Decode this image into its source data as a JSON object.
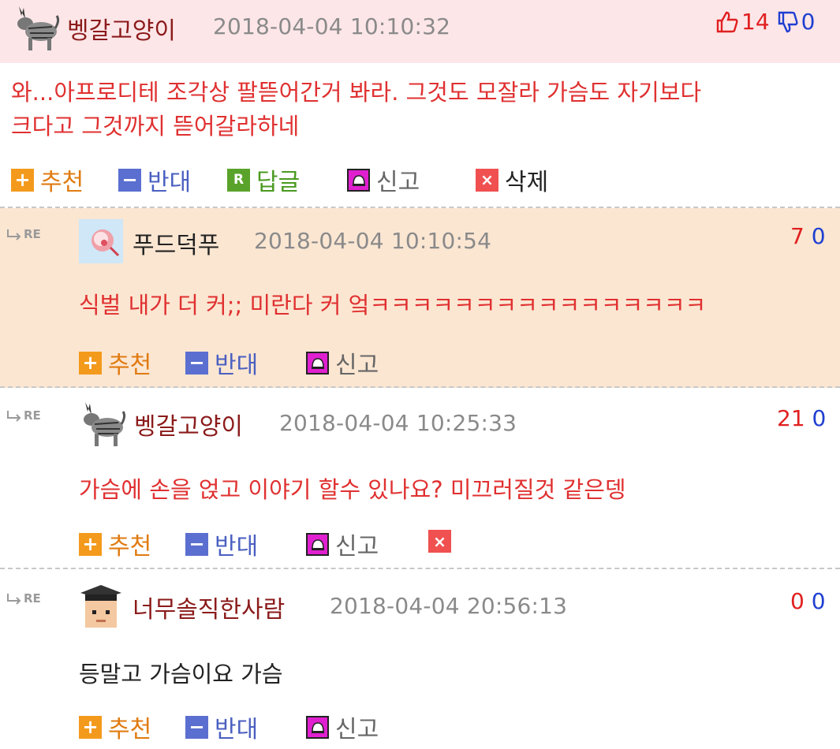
{
  "comments": [
    {
      "author": "벵갈고양이",
      "date": "2018-04-04 10:10:32",
      "up": "14",
      "down": "0",
      "body_lines": [
        "와...아프로디테 조각상 팔뜯어간거 봐라. 그것도 모잘라 가슴도 자기보다",
        "크다고 그것까지 뜯어갈라하네"
      ],
      "actions": {
        "recommend": "추천",
        "oppose": "반대",
        "reply": "답글",
        "report": "신고",
        "delete": "삭제"
      }
    },
    {
      "re": "RE",
      "author": "푸드덕푸",
      "date": "2018-04-04 10:10:54",
      "up": "7",
      "down": "0",
      "body": "식벌 내가 더 커;; 미란다 커 엌ㅋㅋㅋㅋㅋㅋㅋㅋㅋㅋㅋㅋㅋㅋㅋㅋ",
      "actions": {
        "recommend": "추천",
        "oppose": "반대",
        "report": "신고"
      }
    },
    {
      "re": "RE",
      "author": "벵갈고양이",
      "date": "2018-04-04 10:25:33",
      "up": "21",
      "down": "0",
      "body": "가슴에 손을 얹고 이야기 할수 있나요? 미끄러질것 같은뎅",
      "actions": {
        "recommend": "추천",
        "oppose": "반대",
        "report": "신고"
      }
    },
    {
      "re": "RE",
      "author": "너무솔직한사람",
      "date": "2018-04-04 20:56:13",
      "up": "0",
      "down": "0",
      "body": "등말고 가슴이요 가슴",
      "actions": {
        "recommend": "추천",
        "oppose": "반대",
        "report": "신고"
      }
    }
  ],
  "icons": {
    "plus": "+",
    "minus": "−",
    "reply": "R",
    "delete": "×"
  },
  "colors": {
    "up": "#e02020",
    "down": "#1f3fd1",
    "top_bg": "#fde6e8",
    "reply_bg": "#fbe6d2"
  }
}
